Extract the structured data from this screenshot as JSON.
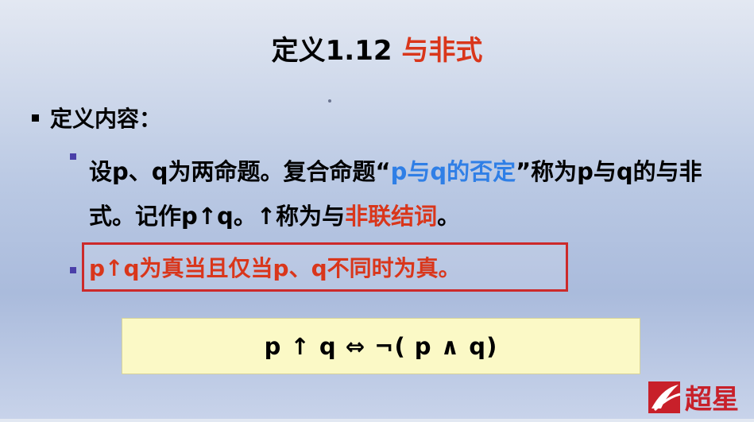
{
  "slide": {
    "title_prefix": "定义1.12 ",
    "title_accent": "与非式",
    "heading": "定义内容：",
    "para_part1": "设p、q为两命题。复合命题“",
    "para_blue": "p与q的否定",
    "para_part2": "”称为p与q的与非式。记作p↑q。↑称为与",
    "para_red": "非联结词",
    "para_end": "。",
    "boxed_text": "p↑q为真当且仅当p、q不同时为真。",
    "formula": "p ↑ q ⇔ ¬( p ∧ q)",
    "logo_text": "超星",
    "colors": {
      "accent_red": "#d9361b",
      "accent_blue": "#2f7fe6",
      "formula_bg": "#fbf9c6",
      "box_border": "#cc2a2a"
    }
  }
}
